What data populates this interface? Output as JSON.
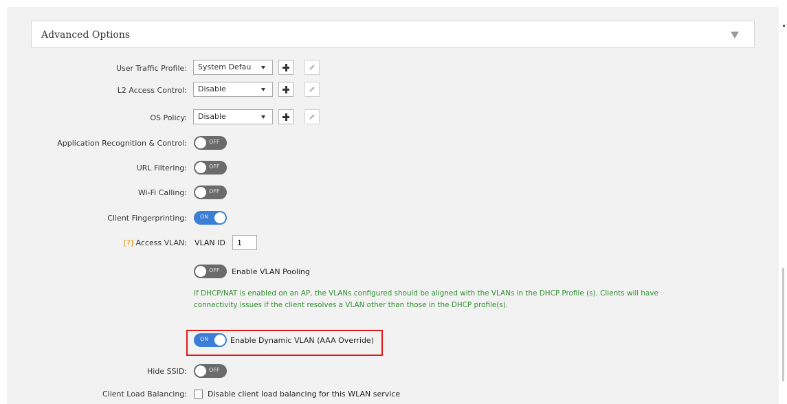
{
  "panel": {
    "title": "Advanced Options"
  },
  "fields": {
    "user_traffic_profile": {
      "label": "User Traffic Profile:",
      "value": "System Defau"
    },
    "l2_access_control": {
      "label": "L2 Access Control:",
      "value": "Disable"
    },
    "os_policy": {
      "label": "OS Policy:",
      "value": "Disable"
    },
    "app_recognition": {
      "label": "Application Recognition & Control:",
      "state": "OFF"
    },
    "url_filtering": {
      "label": "URL Filtering:",
      "state": "OFF"
    },
    "wifi_calling": {
      "label": "Wi-Fi Calling:",
      "state": "OFF"
    },
    "client_fingerprinting": {
      "label": "Client Fingerprinting:",
      "state": "ON"
    },
    "access_vlan": {
      "help": "[?]",
      "label": "Access VLAN:",
      "vlan_id_label": "VLAN ID",
      "vlan_id_value": "1"
    },
    "vlan_pooling": {
      "state": "OFF",
      "label": "Enable VLAN Pooling"
    },
    "dhcp_note": "If DHCP/NAT is enabled on an AP, the VLANs configured should be aligned with the VLANs in the DHCP Profile (s). Clients will have connectivity issues if the client resolves a VLAN other than those in the DHCP profile(s).",
    "dynamic_vlan": {
      "state": "ON",
      "label": "Enable Dynamic VLAN (AAA Override)"
    },
    "hide_ssid": {
      "label": "Hide SSID:",
      "state": "OFF"
    },
    "client_load_balancing": {
      "label": "Client Load Balancing:",
      "checkbox_label": "Disable client load balancing for this WLAN service"
    }
  },
  "colors": {
    "toggle_off": "#6b6b6b",
    "toggle_on": "#3a7ed6",
    "note_text": "#2f8f2f",
    "help_link": "#e08a00",
    "highlight": "#e01818"
  },
  "icons": [
    "collapse-triangle-icon",
    "plus-icon",
    "pencil-edit-icon",
    "dropdown-caret-icon"
  ]
}
